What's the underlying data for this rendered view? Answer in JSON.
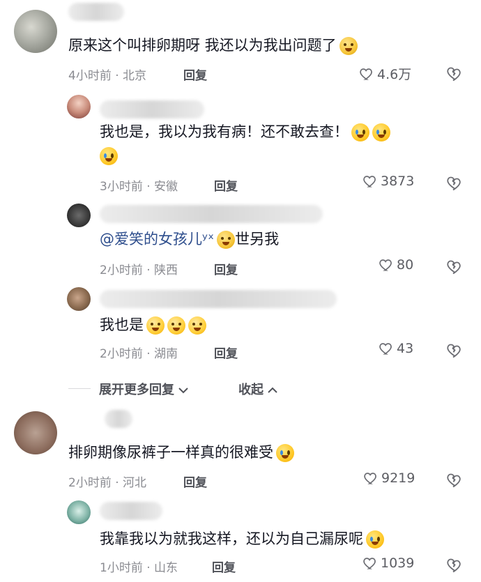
{
  "comments": [
    {
      "text": "原来这个叫排卵期呀 我还以为我出问题了",
      "time": "4小时前 · 北京",
      "reply_label": "回复",
      "likes": "4.6万",
      "emoji": [
        "sad"
      ]
    },
    {
      "text1": "我也是，我以为我有病！还不敢去查！",
      "time": "3小时前 · 安徽",
      "reply_label": "回复",
      "likes": "3873",
      "emoji_line1": [
        "cry",
        "cry"
      ],
      "emoji_line2": [
        "cry"
      ]
    },
    {
      "mention": "@爱笑的女孩儿ʸˣ",
      "text_after": "世另我",
      "time": "2小时前 · 陕西",
      "reply_label": "回复",
      "likes": "80"
    },
    {
      "text": "我也是",
      "time": "2小时前 · 湖南",
      "reply_label": "回复",
      "likes": "43",
      "emoji": [
        "facepalm",
        "facepalm",
        "facepalm"
      ]
    },
    {
      "text": "排卵期像尿裤子一样真的很难受",
      "time": "2小时前 · 河北",
      "reply_label": "回复",
      "likes": "9219",
      "emoji": [
        "cry"
      ]
    },
    {
      "text": "我靠我以为就我这样，还以为自己漏尿呢",
      "time": "1小时前 · 山东",
      "reply_label": "回复",
      "likes": "1039",
      "emoji": [
        "cry"
      ]
    }
  ],
  "expand": {
    "more_label": "展开更多回复",
    "collapse_label": "收起"
  },
  "icons": {
    "like": "heart-icon",
    "dislike": "broken-heart-icon",
    "expand": "chevron-down-icon",
    "collapse": "chevron-up-icon"
  }
}
